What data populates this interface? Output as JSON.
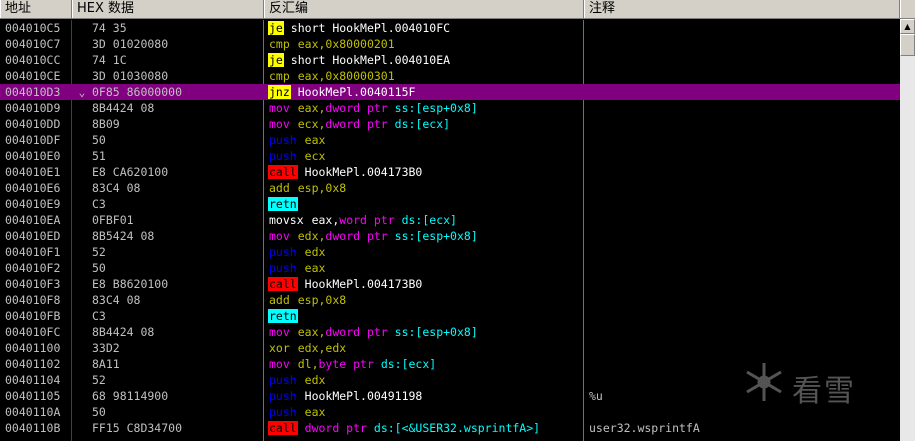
{
  "header": {
    "address": "地址",
    "hex": "HEX 数据",
    "disasm": "反汇编",
    "comment": "注释"
  },
  "watermark": "看雪",
  "colors": {
    "operand": "#ffffff",
    "mov": "#ff00ff",
    "push": "#0000ff",
    "call_bg": "#ff0000",
    "jcc_bg": "#ffff00",
    "ret_bg": "#00ffff",
    "arith": "#c0c000",
    "selected_row": "#800080"
  },
  "rows": [
    {
      "addr": "004010C5",
      "mark": "",
      "hex": "74 35",
      "mn": "je",
      "mt": "jcc",
      "op": "short HookMePl.004010FC",
      "ot": "plain",
      "cmt": ""
    },
    {
      "addr": "004010C7",
      "mark": "",
      "hex": "3D 01020080",
      "mn": "cmp",
      "mt": "arith",
      "op": "eax,0x80000201",
      "ot": "arith",
      "cmt": ""
    },
    {
      "addr": "004010CC",
      "mark": "",
      "hex": "74 1C",
      "mn": "je",
      "mt": "jcc",
      "op": "short HookMePl.004010EA",
      "ot": "plain",
      "cmt": ""
    },
    {
      "addr": "004010CE",
      "mark": "",
      "hex": "3D 01030080",
      "mn": "cmp",
      "mt": "arith",
      "op": "eax,0x80000301",
      "ot": "arith",
      "cmt": ""
    },
    {
      "addr": "004010D3",
      "mark": "⌄",
      "hex": "0F85 86000000",
      "mn": "jnz",
      "mt": "jcc",
      "op": "HookMePl.0040115F",
      "ot": "plain",
      "cmt": "",
      "sel": true
    },
    {
      "addr": "004010D9",
      "mark": "",
      "hex": "8B4424 08",
      "mn": "mov",
      "mt": "mov",
      "op": "eax,dword ptr ss:[esp+0x8]",
      "ot": "memss",
      "cmt": ""
    },
    {
      "addr": "004010DD",
      "mark": "",
      "hex": "8B09",
      "mn": "mov",
      "mt": "mov",
      "op": "ecx,dword ptr ds:[ecx]",
      "ot": "memds",
      "cmt": ""
    },
    {
      "addr": "004010DF",
      "mark": "",
      "hex": "50",
      "mn": "push",
      "mt": "push",
      "op": "eax",
      "ot": "arith",
      "cmt": ""
    },
    {
      "addr": "004010E0",
      "mark": "",
      "hex": "51",
      "mn": "push",
      "mt": "push",
      "op": "ecx",
      "ot": "arith",
      "cmt": ""
    },
    {
      "addr": "004010E1",
      "mark": "",
      "hex": "E8 CA620100",
      "mn": "call",
      "mt": "call",
      "op": "HookMePl.004173B0",
      "ot": "plain",
      "cmt": ""
    },
    {
      "addr": "004010E6",
      "mark": "",
      "hex": "83C4 08",
      "mn": "add",
      "mt": "arith",
      "op": "esp,0x8",
      "ot": "arith",
      "cmt": ""
    },
    {
      "addr": "004010E9",
      "mark": "",
      "hex": "C3",
      "mn": "retn",
      "mt": "ret",
      "op": "",
      "ot": "plain",
      "cmt": ""
    },
    {
      "addr": "004010EA",
      "mark": "",
      "hex": "0FBF01",
      "mn": "movsx",
      "mt": "plainw",
      "op": "eax,word ptr ds:[ecx]",
      "ot": "memdsw",
      "cmt": ""
    },
    {
      "addr": "004010ED",
      "mark": "",
      "hex": "8B5424 08",
      "mn": "mov",
      "mt": "mov",
      "op": "edx,dword ptr ss:[esp+0x8]",
      "ot": "memss",
      "cmt": ""
    },
    {
      "addr": "004010F1",
      "mark": "",
      "hex": "52",
      "mn": "push",
      "mt": "push",
      "op": "edx",
      "ot": "arith",
      "cmt": ""
    },
    {
      "addr": "004010F2",
      "mark": "",
      "hex": "50",
      "mn": "push",
      "mt": "push",
      "op": "eax",
      "ot": "arith",
      "cmt": ""
    },
    {
      "addr": "004010F3",
      "mark": "",
      "hex": "E8 B8620100",
      "mn": "call",
      "mt": "call",
      "op": "HookMePl.004173B0",
      "ot": "plain",
      "cmt": ""
    },
    {
      "addr": "004010F8",
      "mark": "",
      "hex": "83C4 08",
      "mn": "add",
      "mt": "arith",
      "op": "esp,0x8",
      "ot": "arith",
      "cmt": ""
    },
    {
      "addr": "004010FB",
      "mark": "",
      "hex": "C3",
      "mn": "retn",
      "mt": "ret",
      "op": "",
      "ot": "plain",
      "cmt": ""
    },
    {
      "addr": "004010FC",
      "mark": "",
      "hex": "8B4424 08",
      "mn": "mov",
      "mt": "mov",
      "op": "eax,dword ptr ss:[esp+0x8]",
      "ot": "memss",
      "cmt": ""
    },
    {
      "addr": "00401100",
      "mark": "",
      "hex": "33D2",
      "mn": "xor",
      "mt": "arith",
      "op": "edx,edx",
      "ot": "arith",
      "cmt": ""
    },
    {
      "addr": "00401102",
      "mark": "",
      "hex": "8A11",
      "mn": "mov",
      "mt": "mov",
      "op": "dl,byte ptr ds:[ecx]",
      "ot": "memds",
      "cmt": ""
    },
    {
      "addr": "00401104",
      "mark": "",
      "hex": "52",
      "mn": "push",
      "mt": "push",
      "op": "edx",
      "ot": "arith",
      "cmt": ""
    },
    {
      "addr": "00401105",
      "mark": "",
      "hex": "68 98114900",
      "mn": "push",
      "mt": "push",
      "op": "HookMePl.00491198",
      "ot": "plain",
      "cmt": "%u"
    },
    {
      "addr": "0040110A",
      "mark": "",
      "hex": "50",
      "mn": "push",
      "mt": "push",
      "op": "eax",
      "ot": "arith",
      "cmt": ""
    },
    {
      "addr": "0040110B",
      "mark": "",
      "hex": "FF15 C8D34700",
      "mn": "call",
      "mt": "call",
      "op": "dword ptr ds:[<&USER32.wsprintfA>]",
      "ot": "memds",
      "cmt": "user32.wsprintfA"
    }
  ]
}
